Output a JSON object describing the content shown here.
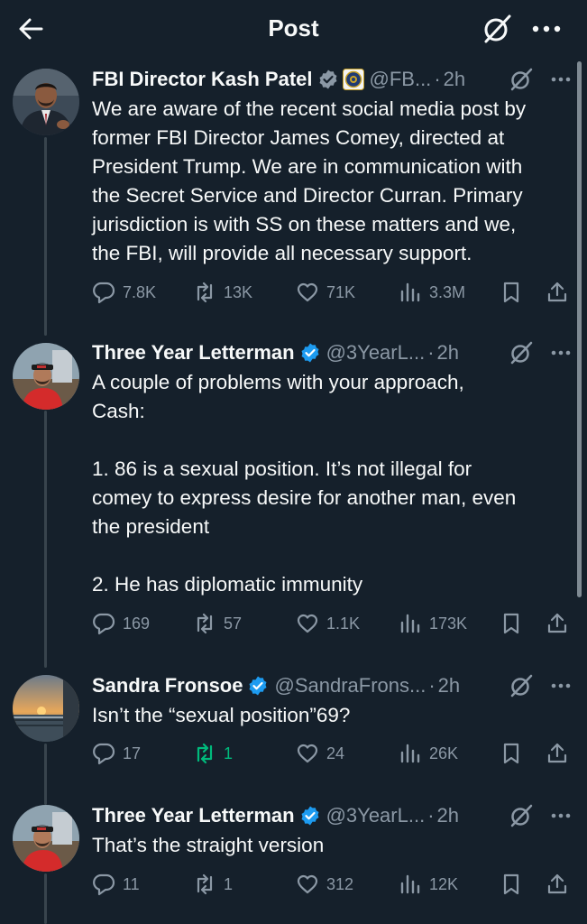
{
  "header": {
    "title": "Post"
  },
  "posts": [
    {
      "name": "FBI Director Kash Patel",
      "handle": "@FB...",
      "time": "2h",
      "text": "We are aware of the recent social media post by\nformer FBI Director James Comey, directed at\nPresident Trump. We are in communication with\nthe Secret Service and Director Curran. Primary\njurisdiction is with SS on these matters and we,\nthe FBI, will provide all necessary support.",
      "replies": "7.8K",
      "reposts": "13K",
      "likes": "71K",
      "views": "3.3M",
      "reposted": false
    },
    {
      "name": "Three Year Letterman",
      "handle": "@3YearL...",
      "time": "2h",
      "text": "A couple of problems with your approach,\nCash:\n\n1. 86 is a sexual position. It’s not illegal for\ncomey to express desire for another man, even\nthe president\n\n2. He has diplomatic immunity",
      "replies": "169",
      "reposts": "57",
      "likes": "1.1K",
      "views": "173K",
      "reposted": false
    },
    {
      "name": "Sandra Fronsoe",
      "handle": "@SandraFrons...",
      "time": "2h",
      "text": "Isn’t the “sexual position”69?",
      "replies": "17",
      "reposts": "1",
      "likes": "24",
      "views": "26K",
      "reposted": true
    },
    {
      "name": "Three Year Letterman",
      "handle": "@3YearL...",
      "time": "2h",
      "text": "That’s the straight version",
      "replies": "11",
      "reposts": "1",
      "likes": "312",
      "views": "12K",
      "reposted": false
    }
  ],
  "colors": {
    "background": "#15202b",
    "verified_blue": "#1d9bf0",
    "muted": "#8b98a5",
    "repost_green": "#00ba7c"
  },
  "icons": [
    "back-arrow-icon",
    "grok-icon",
    "more-icon",
    "verified-badge-icon",
    "fbi-seal-icon",
    "reply-icon",
    "repost-icon",
    "like-icon",
    "views-icon",
    "bookmark-icon",
    "share-icon"
  ]
}
